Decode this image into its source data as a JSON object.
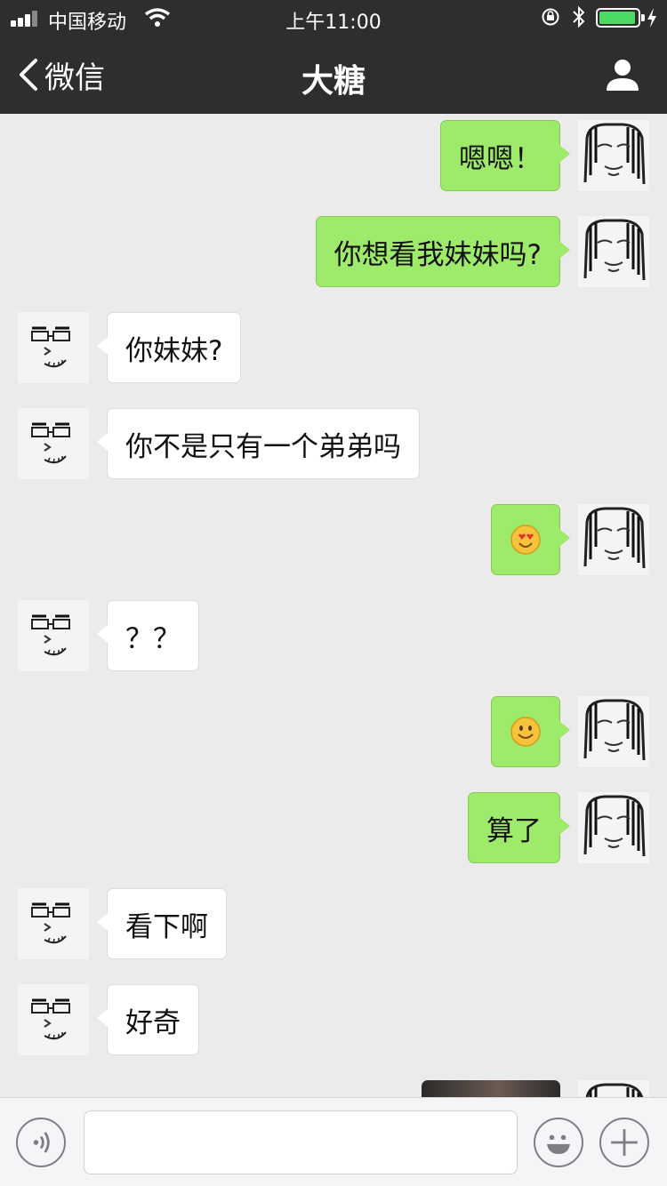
{
  "status_bar": {
    "carrier": "中国移动",
    "time": "上午11:00"
  },
  "nav": {
    "back_label": "微信",
    "title": "大糖"
  },
  "messages": [
    {
      "side": "me",
      "text": "嗯嗯！"
    },
    {
      "side": "me",
      "text": "你想看我妹妹吗?"
    },
    {
      "side": "them",
      "text": "你妹妹?"
    },
    {
      "side": "them",
      "text": "你不是只有一个弟弟吗"
    },
    {
      "side": "me",
      "emoji": "heart-eyes-emoji"
    },
    {
      "side": "them",
      "text": "？？"
    },
    {
      "side": "me",
      "emoji": "smile-emoji"
    },
    {
      "side": "me",
      "text": "算了"
    },
    {
      "side": "them",
      "text": "看下啊"
    },
    {
      "side": "them",
      "text": "好奇"
    },
    {
      "side": "me",
      "image": "photo-thumbnail"
    }
  ],
  "colors": {
    "header_bg": "#2e2e31",
    "my_bubble": "#9eea6a",
    "chat_bg": "#ebebeb",
    "battery": "#4cd964"
  },
  "icons": [
    "signal-icon",
    "wifi-icon",
    "rotation-lock-icon",
    "bluetooth-icon",
    "battery-icon",
    "back-chevron-icon",
    "profile-icon",
    "voice-icon",
    "emoji-icon",
    "plus-icon"
  ]
}
